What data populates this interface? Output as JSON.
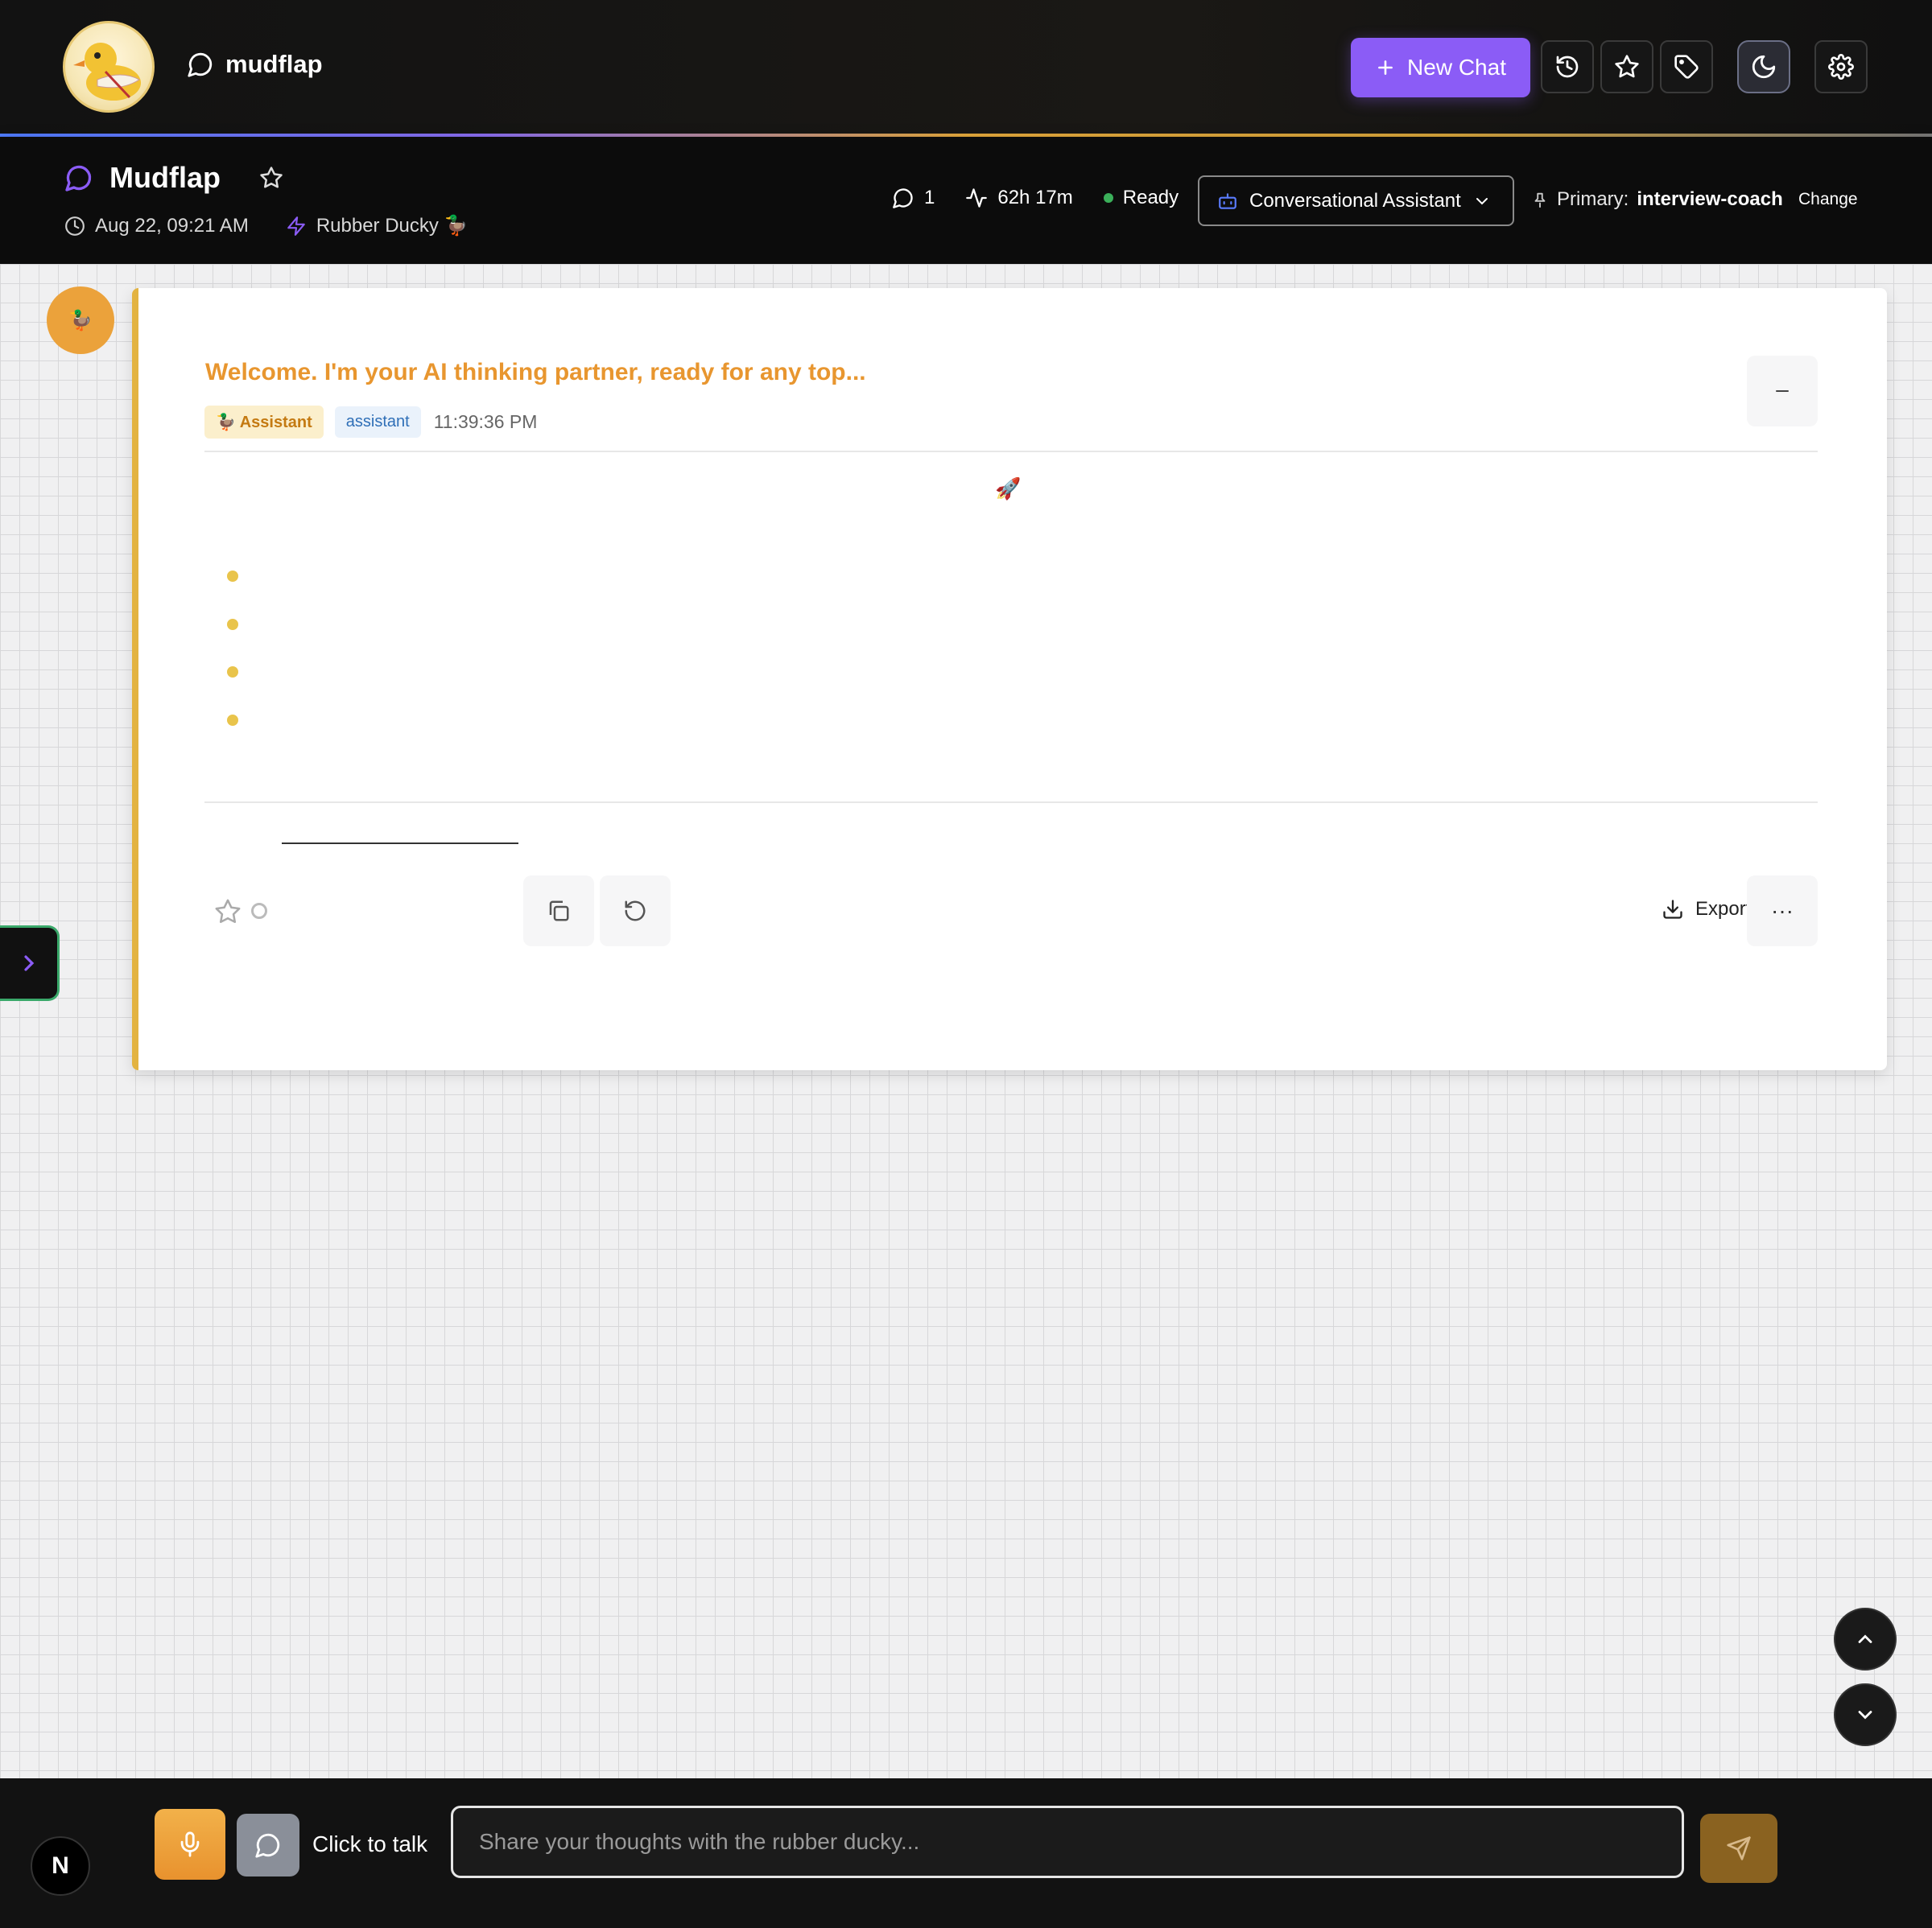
{
  "header": {
    "brand_name": "mudflap",
    "new_chat_label": "New Chat",
    "icons": [
      "history-icon",
      "star-icon",
      "tag-icon",
      "moon-icon",
      "gear-icon"
    ]
  },
  "conversation": {
    "title": "Mudflap",
    "date": "Aug 22, 09:21 AM",
    "persona": "Rubber Ducky 🦆",
    "message_count": "1",
    "duration": "62h 17m",
    "status": "Ready",
    "assistant_select": "Conversational Assistant",
    "primary_label": "Primary:",
    "primary_value": "interview-coach",
    "change_label": "Change"
  },
  "message": {
    "avatar": "🦆",
    "title": "Welcome. I'm your AI thinking partner, ready for any top...",
    "badge_role": "🦆 Assistant",
    "badge_type": "assistant",
    "time": "11:39:36 PM",
    "rocket": "🚀",
    "collapse_label": "–",
    "export_label": "Export",
    "more_label": "···"
  },
  "composer": {
    "n_label": "N",
    "talk_label": "Click to talk",
    "placeholder": "Share your thoughts with the rubber ducky..."
  },
  "colors": {
    "accent_purple": "#8b5cf6",
    "accent_orange": "#e8962f",
    "card_border": "#e3b341",
    "status_green": "#3bb05a"
  }
}
